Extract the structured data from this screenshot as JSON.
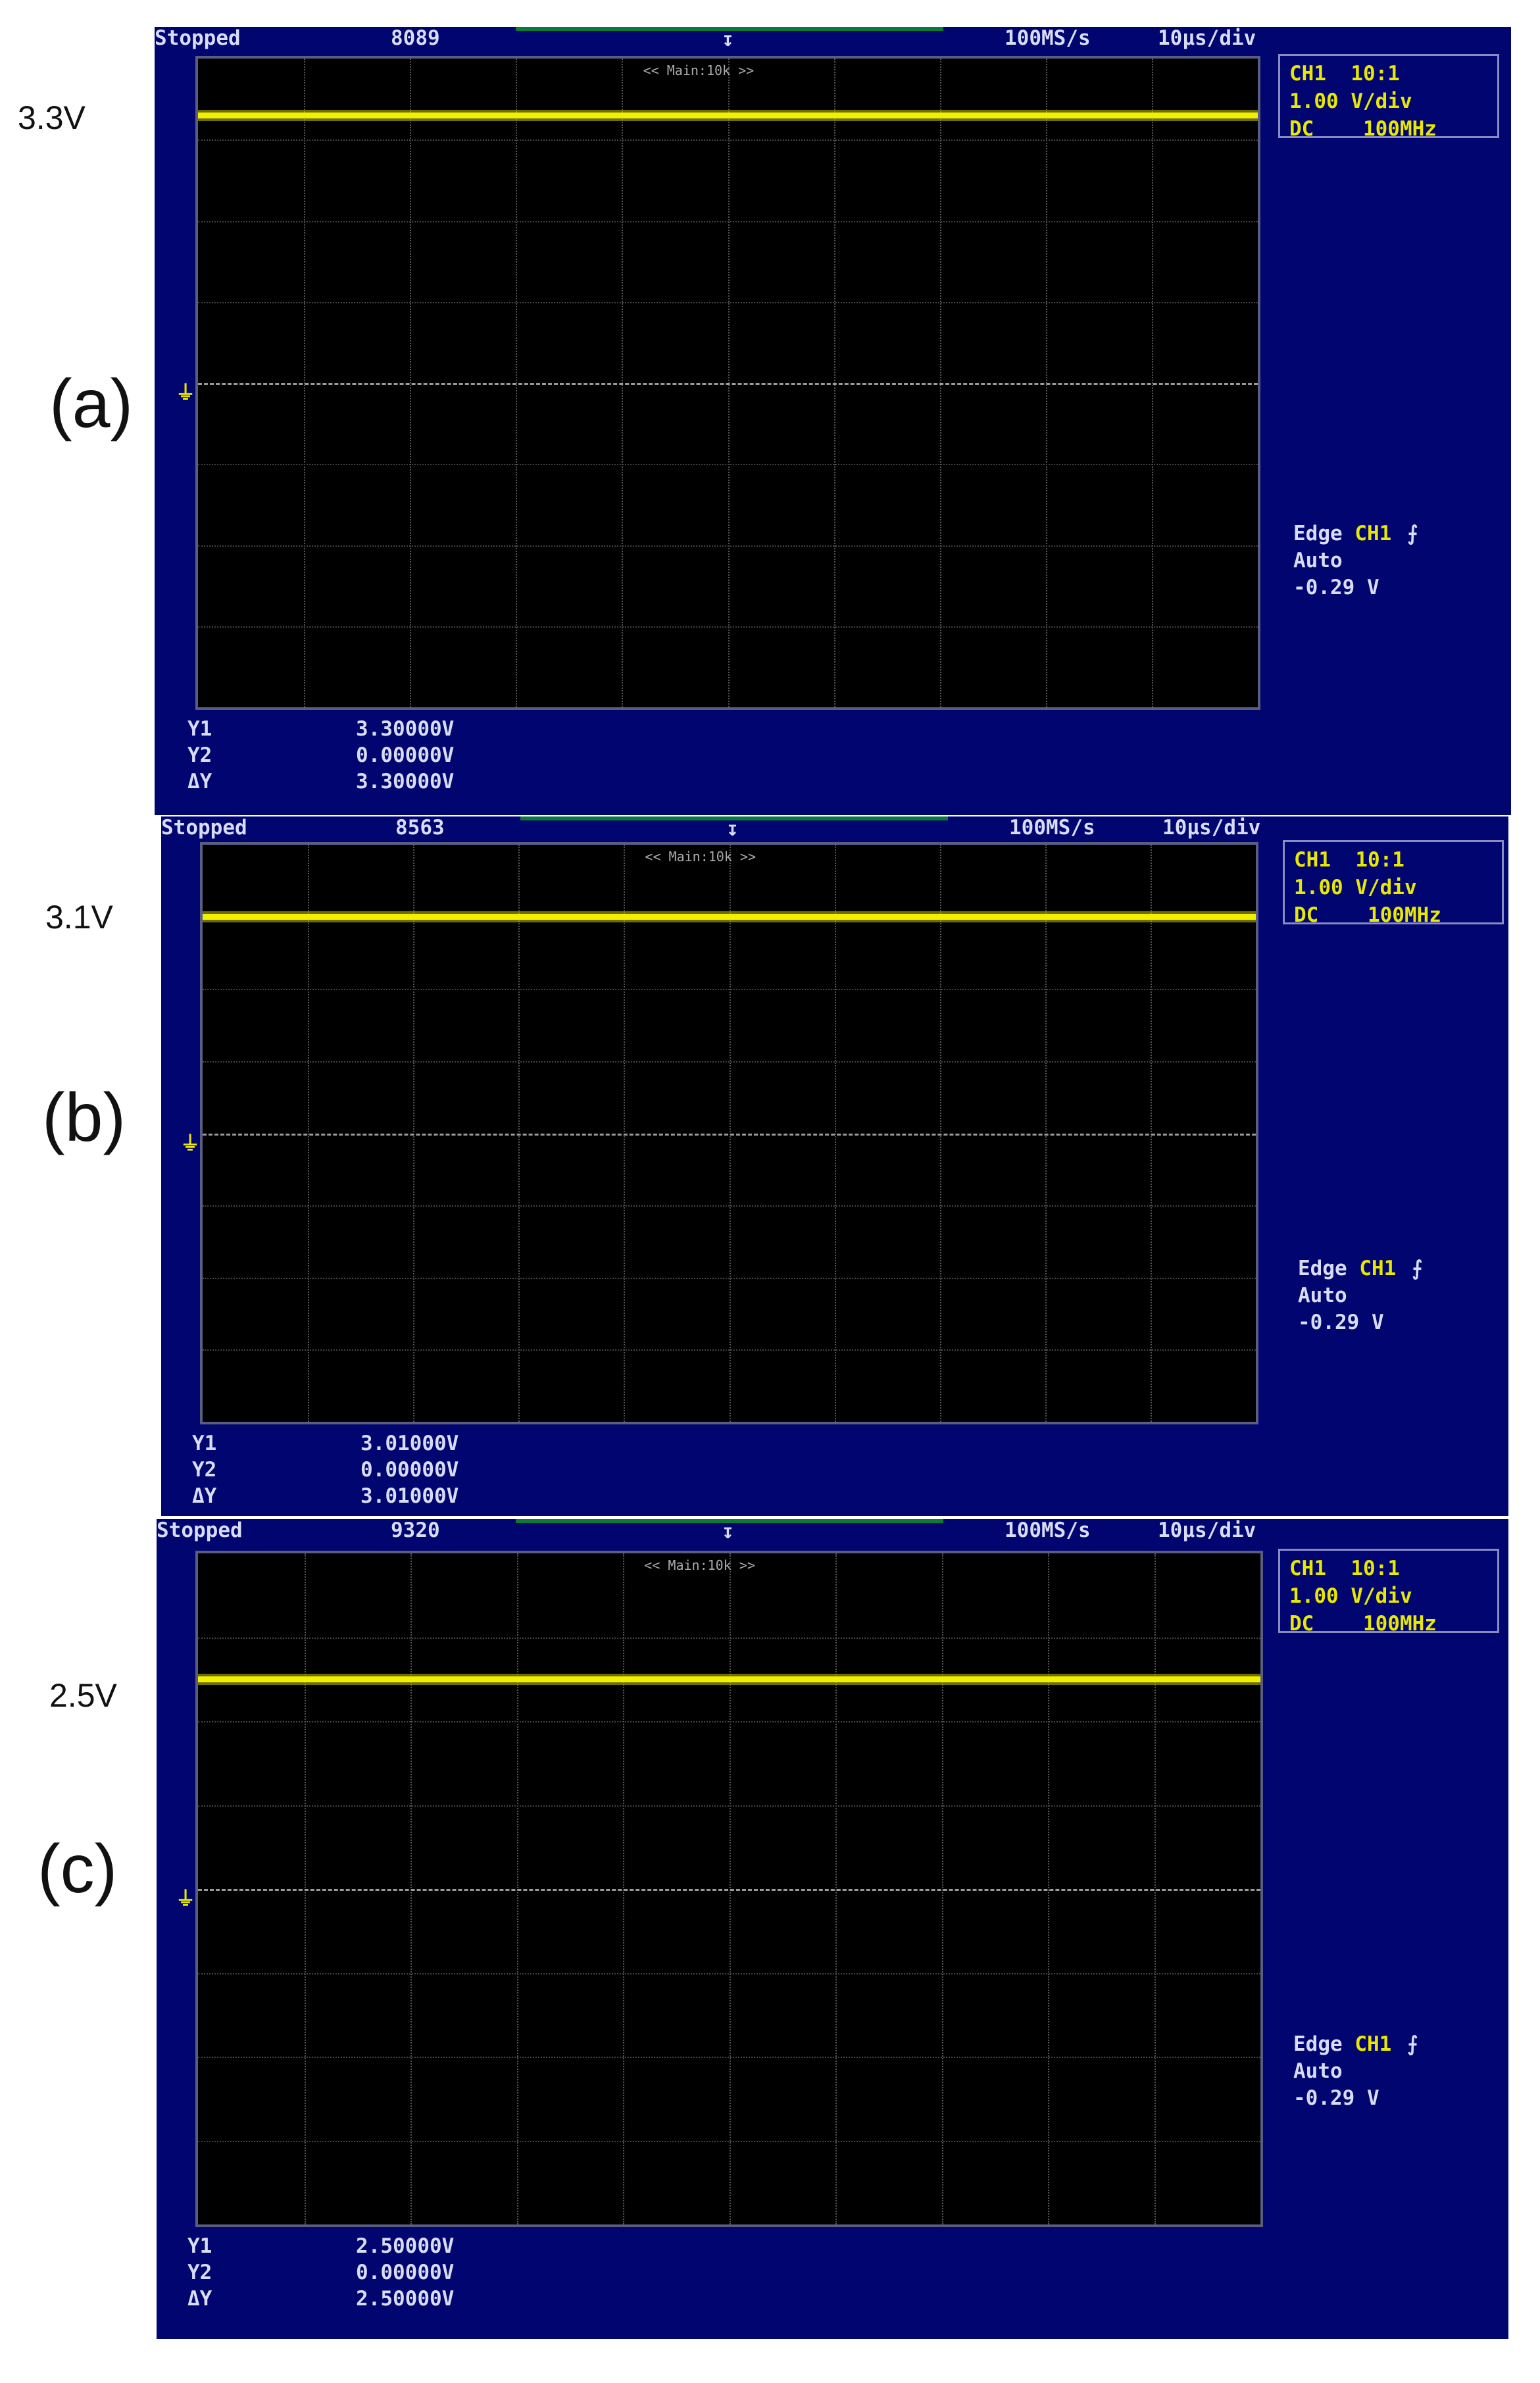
{
  "colors": {
    "screen_bg": "#000570",
    "trace": "#f0f000",
    "grid_bg": "#000000"
  },
  "panels": [
    {
      "id": "a",
      "letter": "(a)",
      "voltage_label": "3.3V",
      "status": "Stopped",
      "counter": "8089",
      "sample_rate": "100MS/s",
      "timebase": "10µs/div",
      "zoom_tag": "<< Main:10k >>",
      "channel": {
        "line1": "CH1  10:1",
        "line2": "1.00 V/div",
        "line3": "DC    100MHz"
      },
      "trigger": {
        "type": "Edge",
        "source": "CH1",
        "mode": "Auto",
        "level": "-0.29 V"
      },
      "cursors": [
        {
          "name": "Y1",
          "value": "3.30000V"
        },
        {
          "name": "Y2",
          "value": "0.00000V"
        },
        {
          "name": "ΔY",
          "value": "3.30000V"
        }
      ],
      "trace_volts": 3.3
    },
    {
      "id": "b",
      "letter": "(b)",
      "voltage_label": "3.1V",
      "status": "Stopped",
      "counter": "8563",
      "sample_rate": "100MS/s",
      "timebase": "10µs/div",
      "zoom_tag": "<< Main:10k >>",
      "channel": {
        "line1": "CH1  10:1",
        "line2": "1.00 V/div",
        "line3": "DC    100MHz"
      },
      "trigger": {
        "type": "Edge",
        "source": "CH1",
        "mode": "Auto",
        "level": "-0.29 V"
      },
      "cursors": [
        {
          "name": "Y1",
          "value": "3.01000V"
        },
        {
          "name": "Y2",
          "value": "0.00000V"
        },
        {
          "name": "ΔY",
          "value": "3.01000V"
        }
      ],
      "trace_volts": 3.01
    },
    {
      "id": "c",
      "letter": "(c)",
      "voltage_label": "2.5V",
      "status": "Stopped",
      "counter": "9320",
      "sample_rate": "100MS/s",
      "timebase": "10µs/div",
      "zoom_tag": "<< Main:10k >>",
      "channel": {
        "line1": "CH1  10:1",
        "line2": "1.00 V/div",
        "line3": "DC    100MHz"
      },
      "trigger": {
        "type": "Edge",
        "source": "CH1",
        "mode": "Auto",
        "level": "-0.29 V"
      },
      "cursors": [
        {
          "name": "Y1",
          "value": "2.50000V"
        },
        {
          "name": "Y2",
          "value": "0.00000V"
        },
        {
          "name": "ΔY",
          "value": "2.50000V"
        }
      ],
      "trace_volts": 2.5
    }
  ]
}
